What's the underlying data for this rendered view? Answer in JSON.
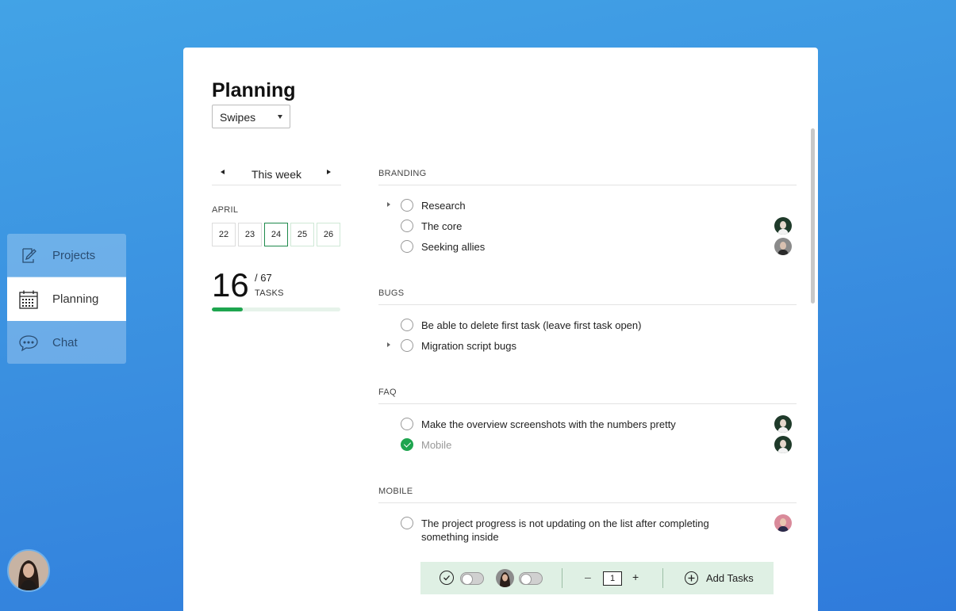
{
  "nav": {
    "items": [
      {
        "label": "Projects",
        "icon": "edit-icon"
      },
      {
        "label": "Planning",
        "icon": "calendar-icon"
      },
      {
        "label": "Chat",
        "icon": "chat-icon"
      }
    ],
    "active": "Planning"
  },
  "header": {
    "title": "Planning",
    "project_select": "Swipes"
  },
  "calendar": {
    "week_label": "This week",
    "month": "APRIL",
    "days": [
      "22",
      "23",
      "24",
      "25",
      "26"
    ],
    "selected_day": "24"
  },
  "stats": {
    "completed": "16",
    "total": "/ 67",
    "label": "TASKS",
    "progress_fraction": 0.24
  },
  "sections": [
    {
      "title": "BRANDING",
      "tasks": [
        {
          "text": "Research",
          "done": false,
          "expandable": true,
          "assignee": null
        },
        {
          "text": "The core",
          "done": false,
          "expandable": false,
          "assignee": "avatar-man-dark"
        },
        {
          "text": "Seeking allies",
          "done": false,
          "expandable": false,
          "assignee": "avatar-man-gray"
        }
      ]
    },
    {
      "title": "BUGS",
      "tasks": [
        {
          "text": "Be able to delete first task (leave first task open)",
          "done": false,
          "expandable": false,
          "assignee": null
        },
        {
          "text": "Migration script bugs",
          "done": false,
          "expandable": true,
          "assignee": null
        }
      ]
    },
    {
      "title": "FAQ",
      "tasks": [
        {
          "text": "Make the overview screenshots with the numbers pretty",
          "done": false,
          "expandable": false,
          "assignee": "avatar-man-dark"
        },
        {
          "text": "Mobile",
          "done": true,
          "expandable": false,
          "assignee": "avatar-man-dark"
        }
      ]
    },
    {
      "title": "MOBILE",
      "tasks": [
        {
          "text": "The project progress is not updating on the list after completing something inside",
          "done": false,
          "expandable": false,
          "assignee": "avatar-man-pink"
        }
      ]
    }
  ],
  "toolbar": {
    "stepper_value": "1",
    "minus": "–",
    "plus": "+",
    "add_tasks_label": "Add Tasks"
  },
  "colors": {
    "accent_green": "#1ea54f",
    "background_blue": "#3a8fe0",
    "toolbar_bg": "#dff0e4"
  }
}
